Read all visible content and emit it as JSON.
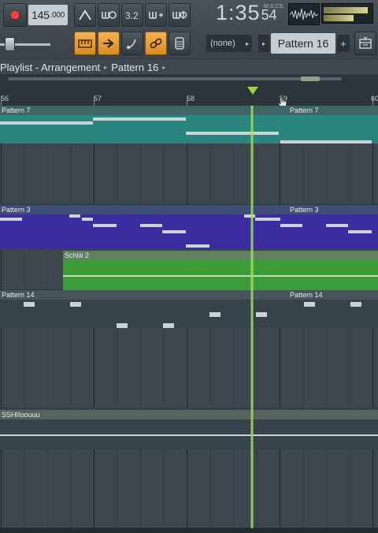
{
  "toolbar": {
    "tempo_main": "145",
    "tempo_fraction": ".000",
    "time_main": "1:35",
    "time_sub": "54",
    "time_mode": "M:S:CS",
    "pattern_none": "(none)",
    "pattern_selected": "Pattern 16",
    "pattern_add": "+"
  },
  "playlist": {
    "title": "Playlist - Arrangement",
    "current_pattern": "Pattern 16"
  },
  "ruler": {
    "bars": [
      "56",
      "57",
      "58",
      "59",
      "60"
    ]
  },
  "tracks": [
    {
      "clip_a": "Pattern 7",
      "clip_b": "Pattern 7"
    },
    {
      "clip_a": "Pattern 3",
      "clip_b": "Pattern 3"
    },
    {
      "clip_a": "Schiiii 2"
    },
    {
      "clip_a": "Pattern 14",
      "clip_b": "Pattern 14"
    },
    {
      "clip_a": "SSHIIoouuu"
    }
  ],
  "colors": {
    "teal": "#2f8c85",
    "purple": "#3c2fa0",
    "green": "#3d9c3a",
    "playhead": "#a6e05a",
    "accent_orange": "#f0a33c"
  }
}
